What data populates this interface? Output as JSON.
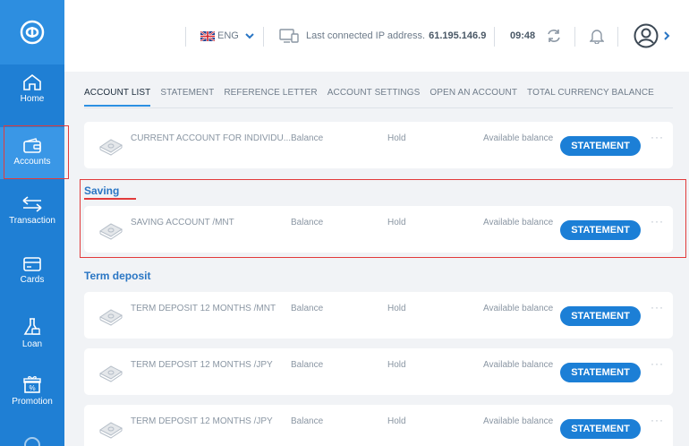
{
  "header": {
    "language": "ENG",
    "last_ip_label": "Last connected IP address.",
    "last_ip_value": "61.195.146.9",
    "time": "09:48"
  },
  "sidebar": {
    "items": [
      {
        "label": "Home",
        "icon": "home-icon"
      },
      {
        "label": "Accounts",
        "icon": "wallet-icon"
      },
      {
        "label": "Transaction",
        "icon": "transfer-arrows-icon"
      },
      {
        "label": "Cards",
        "icon": "card-icon"
      },
      {
        "label": "Loan",
        "icon": "loan-flask-icon"
      },
      {
        "label": "Promotion",
        "icon": "gift-percent-icon"
      }
    ]
  },
  "tabs": [
    "ACCOUNT LIST",
    "STATEMENT",
    "REFERENCE LETTER",
    "ACCOUNT SETTINGS",
    "OPEN AN ACCOUNT",
    "TOTAL CURRENCY BALANCE"
  ],
  "sections": {
    "saving": "Saving",
    "term_deposit": "Term deposit"
  },
  "labels": {
    "balance": "Balance",
    "hold": "Hold",
    "available": "Available balance",
    "statement_button": "STATEMENT",
    "more": "···"
  },
  "accounts": [
    {
      "name": "CURRENT ACCOUNT FOR INDIVIDU..."
    },
    {
      "name": "SAVING ACCOUNT /MNT"
    },
    {
      "name": "TERM DEPOSIT 12 MONTHS /MNT"
    },
    {
      "name": "TERM DEPOSIT 12 MONTHS /JPY"
    },
    {
      "name": "TERM DEPOSIT 12 MONTHS /JPY"
    }
  ],
  "colors": {
    "sidebar": "#1f7fd4",
    "accent": "#1c7fd6",
    "annotation": "#e23b3b"
  }
}
